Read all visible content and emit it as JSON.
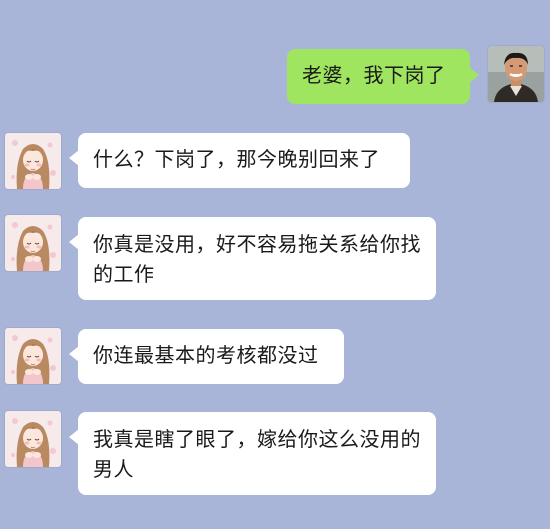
{
  "conversation": {
    "messages": [
      {
        "sender": "self",
        "avatar": "man-portrait-icon",
        "text": "老婆，我下岗了"
      },
      {
        "sender": "other",
        "avatar": "girl-anime-icon",
        "text": "什么？下岗了，那今晚别回来了"
      },
      {
        "sender": "other",
        "avatar": "girl-anime-icon",
        "text": "你真是没用，好不容易拖关系给你找的工作"
      },
      {
        "sender": "other",
        "avatar": "girl-anime-icon",
        "text": "你连最基本的考核都没过"
      },
      {
        "sender": "other",
        "avatar": "girl-anime-icon",
        "text": "我真是瞎了眼了，嫁给你这么没用的男人"
      }
    ]
  },
  "colors": {
    "background": "#a8b5d9",
    "self_bubble": "#9fe55f",
    "other_bubble": "#ffffff"
  }
}
